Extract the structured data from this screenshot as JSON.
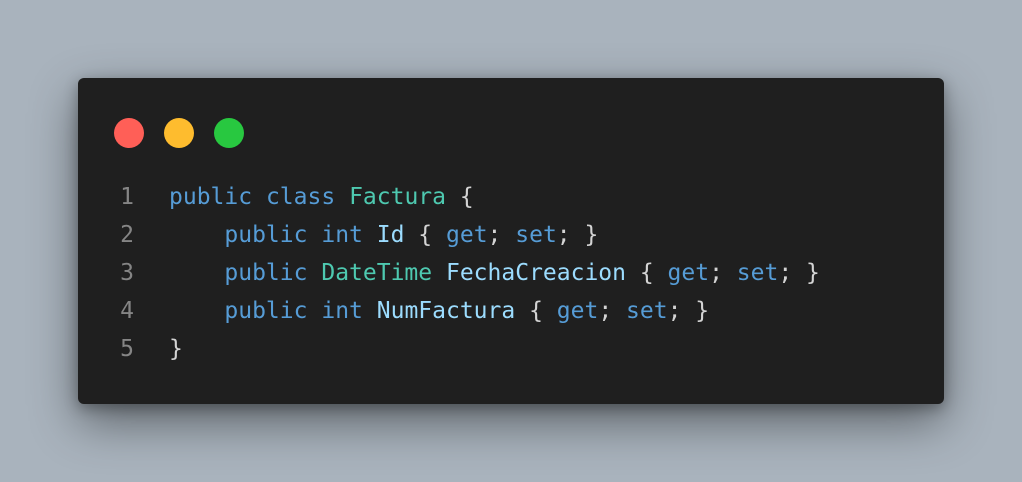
{
  "window": {
    "controls": [
      {
        "name": "close",
        "color": "#ff5f57"
      },
      {
        "name": "minimize",
        "color": "#febc2e"
      },
      {
        "name": "maximize",
        "color": "#28c840"
      }
    ]
  },
  "code": {
    "lines": [
      {
        "number": "1",
        "tokens": [
          {
            "text": "public",
            "kind": "kw"
          },
          {
            "text": " ",
            "kind": "punct"
          },
          {
            "text": "class",
            "kind": "kw"
          },
          {
            "text": " ",
            "kind": "punct"
          },
          {
            "text": "Factura",
            "kind": "type"
          },
          {
            "text": " {",
            "kind": "punct"
          }
        ]
      },
      {
        "number": "2",
        "tokens": [
          {
            "text": "    ",
            "kind": "punct"
          },
          {
            "text": "public",
            "kind": "kw"
          },
          {
            "text": " ",
            "kind": "punct"
          },
          {
            "text": "int",
            "kind": "kw"
          },
          {
            "text": " ",
            "kind": "punct"
          },
          {
            "text": "Id",
            "kind": "prop"
          },
          {
            "text": " { ",
            "kind": "punct"
          },
          {
            "text": "get",
            "kind": "kw"
          },
          {
            "text": "; ",
            "kind": "punct"
          },
          {
            "text": "set",
            "kind": "kw"
          },
          {
            "text": "; }",
            "kind": "punct"
          }
        ]
      },
      {
        "number": "3",
        "tokens": [
          {
            "text": "    ",
            "kind": "punct"
          },
          {
            "text": "public",
            "kind": "kw"
          },
          {
            "text": " ",
            "kind": "punct"
          },
          {
            "text": "DateTime",
            "kind": "type"
          },
          {
            "text": " ",
            "kind": "punct"
          },
          {
            "text": "FechaCreacion",
            "kind": "prop"
          },
          {
            "text": " { ",
            "kind": "punct"
          },
          {
            "text": "get",
            "kind": "kw"
          },
          {
            "text": "; ",
            "kind": "punct"
          },
          {
            "text": "set",
            "kind": "kw"
          },
          {
            "text": "; }",
            "kind": "punct"
          }
        ]
      },
      {
        "number": "4",
        "tokens": [
          {
            "text": "    ",
            "kind": "punct"
          },
          {
            "text": "public",
            "kind": "kw"
          },
          {
            "text": " ",
            "kind": "punct"
          },
          {
            "text": "int",
            "kind": "kw"
          },
          {
            "text": " ",
            "kind": "punct"
          },
          {
            "text": "NumFactura",
            "kind": "prop"
          },
          {
            "text": " { ",
            "kind": "punct"
          },
          {
            "text": "get",
            "kind": "kw"
          },
          {
            "text": "; ",
            "kind": "punct"
          },
          {
            "text": "set",
            "kind": "kw"
          },
          {
            "text": "; }",
            "kind": "punct"
          }
        ]
      },
      {
        "number": "5",
        "tokens": [
          {
            "text": "}",
            "kind": "punct"
          }
        ]
      }
    ]
  }
}
